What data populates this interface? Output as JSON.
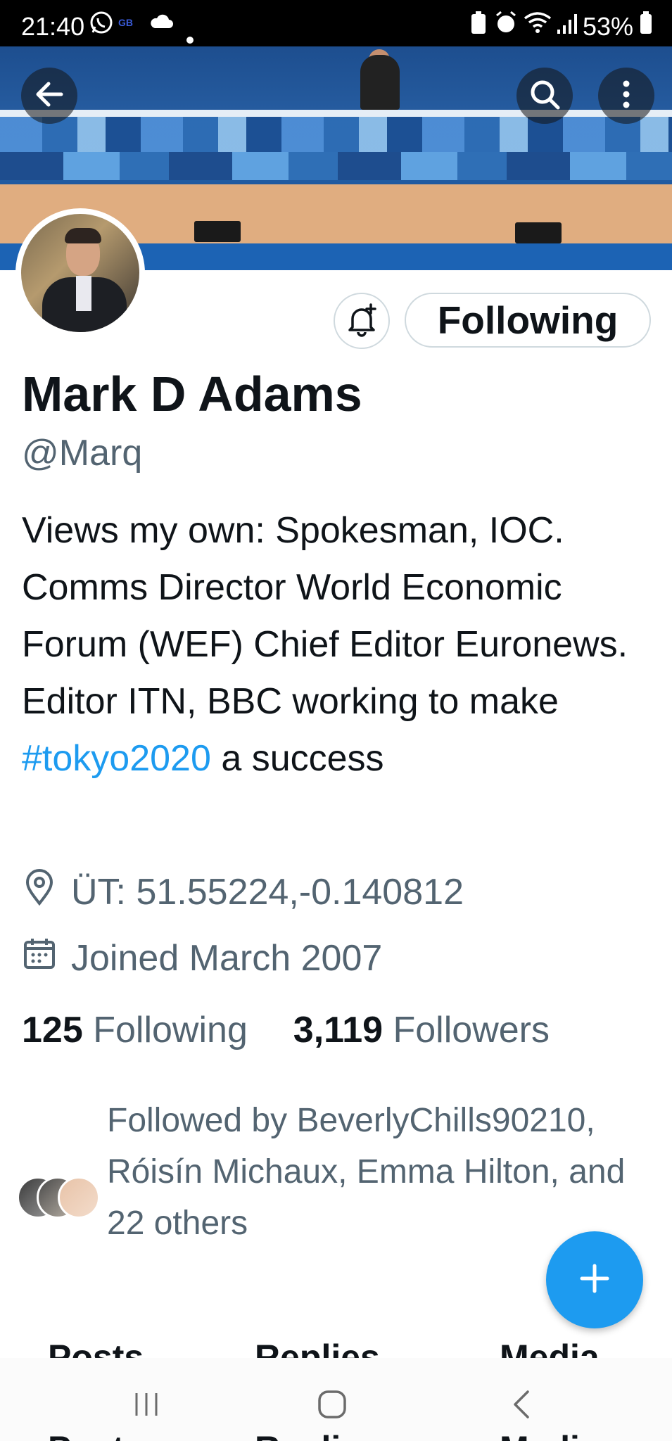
{
  "status_bar": {
    "time": "21:40",
    "battery": "53%",
    "icons": [
      "whatsapp-icon",
      "gb-news-icon",
      "cloud-icon",
      "dot-icon",
      "battery-saver-icon",
      "alarm-icon",
      "wifi-icon",
      "signal-icon",
      "battery-icon"
    ]
  },
  "header": {
    "icons": [
      "back-arrow-icon",
      "search-icon",
      "more-vertical-icon"
    ]
  },
  "actions": {
    "bell_icon": "notification-bell-plus-icon",
    "following_label": "Following"
  },
  "profile": {
    "name": "Mark D Adams",
    "handle": "@Marq",
    "bio_text": "Views my own: Spokesman, IOC. Comms Director World Economic Forum (WEF) Chief Editor Euronews. Editor ITN, BBC working to make",
    "bio_hashtag": "#tokyo2020",
    "bio_suffix": " a success",
    "location": "ÜT: 51.55224,-0.140812",
    "joined": "Joined March 2007",
    "following_count": "125",
    "following_label": "Following",
    "followers_count": "3,119",
    "followers_label": "Followers",
    "followed_by": "Followed by BeverlyChills90210, Róisín Michaux, Emma Hilton, and 22 others"
  },
  "tabs": [
    "Posts",
    "Replies",
    "Media"
  ],
  "colors": {
    "accent": "#1d9bf0",
    "text": "#0f1419",
    "secondary": "#536471",
    "border": "#cfd9de"
  },
  "nav_icons": [
    "recent-apps-icon",
    "home-icon",
    "back-icon"
  ]
}
